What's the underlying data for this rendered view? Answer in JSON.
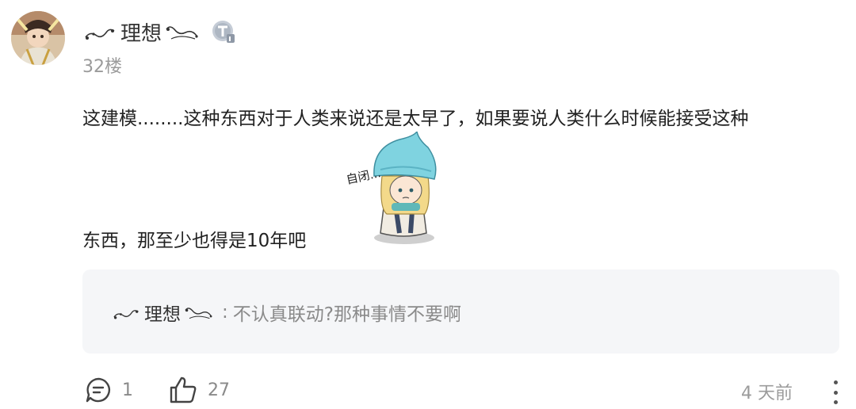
{
  "comment": {
    "username": "理想",
    "floor": "32楼",
    "content_line1": "这建模........这种东西对于人类来说还是太早了，如果要说人类什么时候能接受这种",
    "content_line2": "东西，那至少也得是10年吧",
    "sticker_text": "自闭..."
  },
  "reply": {
    "username": "理想",
    "separator": ":",
    "text": "不认真联动?那种事情不要啊"
  },
  "actions": {
    "comment_icon": "comment-bubble-icon",
    "comment_count": "1",
    "like_icon": "thumbs-up-icon",
    "like_count": "27",
    "time": "4 天前",
    "more_icon": "more-vertical-icon"
  },
  "colors": {
    "reply_background": "#f5f6f8",
    "meta_gray": "#9b9b9b",
    "sticker_hat": "#7fd3e0"
  }
}
